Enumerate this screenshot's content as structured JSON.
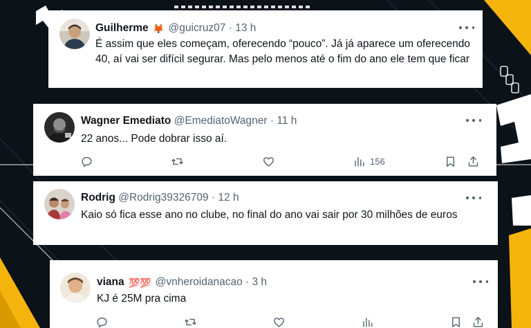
{
  "colors": {
    "background": "#0b1218",
    "accent_yellow": "#f5b40b",
    "card": "#ffffff",
    "text_primary": "#0f1419",
    "text_secondary": "#536471"
  },
  "tweets": [
    {
      "name": "Guilherme",
      "badge_emoji": "🦊",
      "handle": "@guicruz07",
      "separator": "·",
      "time": "13 h",
      "text": "É assim que eles começam, oferecendo “pouco”. Já já aparece um oferecendo 40, aí vai ser difícil segurar. Mas pelo menos até o fim do ano ele tem que ficar"
    },
    {
      "name": "Wagner Emediato",
      "handle": "@EmediatoWagner",
      "separator": "·",
      "time": "11 h",
      "text": "22 anos... Pode dobrar isso aí.",
      "views_count": "156"
    },
    {
      "name": "Rodrig",
      "handle": "@Rodrig39326709",
      "separator": "·",
      "time": "12 h",
      "text": "Kaio só fica esse ano no clube, no final do ano vai sair por 30 milhões de euros"
    },
    {
      "name": "viana",
      "badge_emoji": "💯💯",
      "handle": "@vnheroidanacao",
      "separator": "·",
      "time": "3 h",
      "text": "KJ é 25M pra cima"
    }
  ],
  "icons": [
    "more-icon",
    "reply-icon",
    "retweet-icon",
    "like-icon",
    "views-icon",
    "bookmark-icon",
    "share-icon"
  ]
}
